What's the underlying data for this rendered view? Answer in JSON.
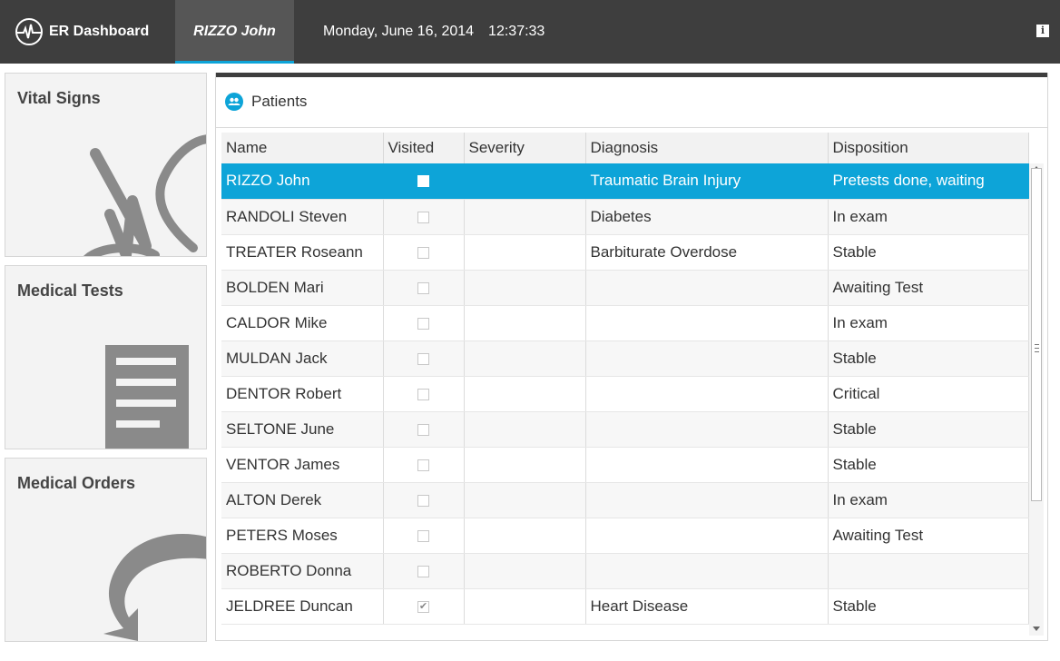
{
  "app": {
    "title": "ER Dashboard",
    "patient_tab": "RIZZO John",
    "date": "Monday, June 16, 2014",
    "time": "12:37:33",
    "info_label": "i"
  },
  "tiles": [
    {
      "label": "Vital Signs",
      "icon": "vital-signs-icon"
    },
    {
      "label": "Medical Tests",
      "icon": "document-icon"
    },
    {
      "label": "Medical Orders",
      "icon": "arrow-icon"
    }
  ],
  "panel": {
    "title": "Patients",
    "icon": "people-icon"
  },
  "table": {
    "columns": [
      "Name",
      "Visited",
      "Severity",
      "Diagnosis",
      "Disposition"
    ],
    "rows": [
      {
        "name": "RIZZO John",
        "visited": false,
        "severity": "",
        "diagnosis": "Traumatic Brain Injury",
        "disposition": "Pretests done, waiting",
        "selected": true
      },
      {
        "name": "RANDOLI Steven",
        "visited": false,
        "severity": "",
        "diagnosis": "Diabetes",
        "disposition": "In exam"
      },
      {
        "name": "TREATER Roseann",
        "visited": false,
        "severity": "",
        "diagnosis": "Barbiturate Overdose",
        "disposition": "Stable"
      },
      {
        "name": "BOLDEN Mari",
        "visited": false,
        "severity": "",
        "diagnosis": "",
        "disposition": "Awaiting Test"
      },
      {
        "name": "CALDOR Mike",
        "visited": false,
        "severity": "",
        "diagnosis": "",
        "disposition": "In exam"
      },
      {
        "name": "MULDAN Jack",
        "visited": false,
        "severity": "",
        "diagnosis": "",
        "disposition": "Stable"
      },
      {
        "name": "DENTOR Robert",
        "visited": false,
        "severity": "",
        "diagnosis": "",
        "disposition": "Critical"
      },
      {
        "name": "SELTONE June",
        "visited": false,
        "severity": "",
        "diagnosis": "",
        "disposition": "Stable"
      },
      {
        "name": "VENTOR James",
        "visited": false,
        "severity": "",
        "diagnosis": "",
        "disposition": "Stable"
      },
      {
        "name": "ALTON Derek",
        "visited": false,
        "severity": "",
        "diagnosis": "",
        "disposition": "In exam"
      },
      {
        "name": "PETERS Moses",
        "visited": false,
        "severity": "",
        "diagnosis": "",
        "disposition": "Awaiting Test"
      },
      {
        "name": "ROBERTO Donna",
        "visited": false,
        "severity": "",
        "diagnosis": "",
        "disposition": ""
      },
      {
        "name": "JELDREE Duncan",
        "visited": true,
        "severity": "",
        "diagnosis": "Heart Disease",
        "disposition": "Stable"
      }
    ]
  },
  "colors": {
    "topbar": "#3e3e3e",
    "accent": "#0da4d8",
    "tile_bg": "#f3f3f3",
    "icon_gray": "#8a8a8a"
  }
}
